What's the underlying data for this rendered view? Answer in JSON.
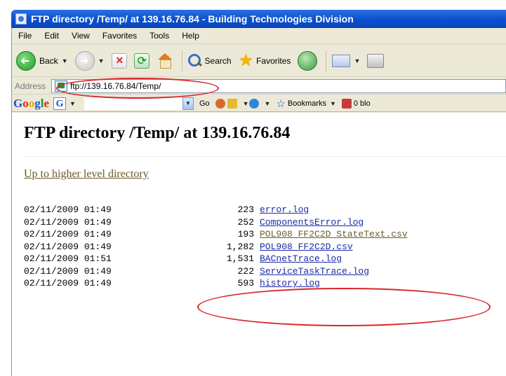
{
  "window": {
    "title": "FTP directory /Temp/ at 139.16.76.84 - Building Technologies Division"
  },
  "menu": [
    "File",
    "Edit",
    "View",
    "Favorites",
    "Tools",
    "Help"
  ],
  "toolbar": {
    "back_label": "Back",
    "search_label": "Search",
    "favorites_label": "Favorites"
  },
  "address": {
    "label": "Address",
    "url": "ftp://139.16.76.84/Temp/"
  },
  "googlebar": {
    "logo": [
      "G",
      "o",
      "o",
      "g",
      "l",
      "e"
    ],
    "g_box": "G",
    "go_label": "Go",
    "bookmarks_label": "Bookmarks",
    "blocked_label": "0 blo"
  },
  "page": {
    "title": "FTP directory /Temp/ at 139.16.76.84",
    "up_link": "Up to higher level directory",
    "files": [
      {
        "date": "02/11/2009 01:49",
        "size": "223",
        "name": "error.log",
        "visited": false
      },
      {
        "date": "02/11/2009 01:49",
        "size": "252",
        "name": "ComponentsError.log",
        "visited": false
      },
      {
        "date": "02/11/2009 01:49",
        "size": "193",
        "name": "POL908_FF2C2D_StateText.csv",
        "visited": true
      },
      {
        "date": "02/11/2009 01:49",
        "size": "1,282",
        "name": "POL908_FF2C2D.csv",
        "visited": false
      },
      {
        "date": "02/11/2009 01:51",
        "size": "1,531",
        "name": "BACnetTrace.log",
        "visited": false
      },
      {
        "date": "02/11/2009 01:49",
        "size": "222",
        "name": "ServiceTaskTrace.log",
        "visited": false
      },
      {
        "date": "02/11/2009 01:49",
        "size": "593",
        "name": "history.log",
        "visited": false
      }
    ]
  },
  "colors": {
    "annotation": "#d8262a",
    "link": "#1a2aa8",
    "visited_link": "#6a5a2a",
    "titlebar": "#0a4fcf"
  }
}
